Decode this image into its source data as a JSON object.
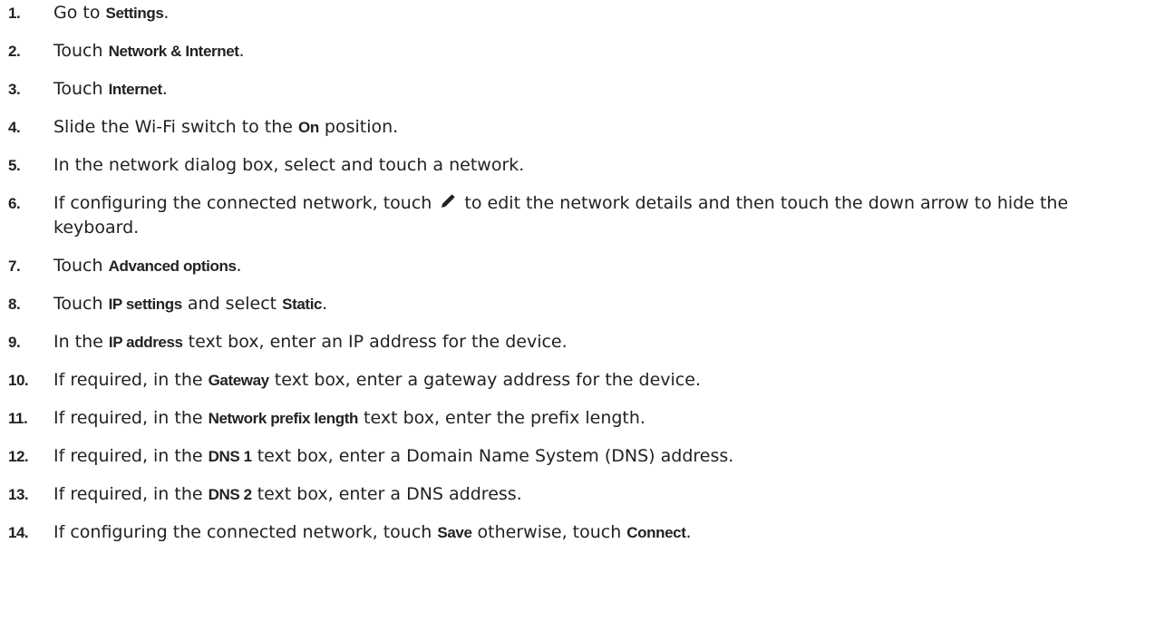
{
  "steps": [
    {
      "num": "1.",
      "parts": [
        {
          "t": "Go to "
        },
        {
          "b": "Settings"
        },
        {
          "t": "."
        }
      ]
    },
    {
      "num": "2.",
      "parts": [
        {
          "t": "Touch "
        },
        {
          "b": "Network & Internet"
        },
        {
          "t": "."
        }
      ]
    },
    {
      "num": "3.",
      "parts": [
        {
          "t": "Touch "
        },
        {
          "b": "Internet"
        },
        {
          "t": "."
        }
      ]
    },
    {
      "num": "4.",
      "parts": [
        {
          "t": "Slide the Wi-Fi switch to the "
        },
        {
          "b": "On"
        },
        {
          "t": " position."
        }
      ]
    },
    {
      "num": "5.",
      "parts": [
        {
          "t": "In the network dialog box, select and touch a network."
        }
      ]
    },
    {
      "num": "6.",
      "parts": [
        {
          "t": "If configuring the connected network, touch "
        },
        {
          "icon": "pencil-icon"
        },
        {
          "t": " to edit the network details and then touch the down arrow to hide the keyboard."
        }
      ]
    },
    {
      "num": "7.",
      "parts": [
        {
          "t": "Touch "
        },
        {
          "b": "Advanced options"
        },
        {
          "t": "."
        }
      ]
    },
    {
      "num": "8.",
      "parts": [
        {
          "t": "Touch "
        },
        {
          "b": "IP settings"
        },
        {
          "t": " and select "
        },
        {
          "b": "Static"
        },
        {
          "t": "."
        }
      ]
    },
    {
      "num": "9.",
      "parts": [
        {
          "t": "In the "
        },
        {
          "b": "IP address"
        },
        {
          "t": " text box, enter an IP address for the device."
        }
      ]
    },
    {
      "num": "10.",
      "parts": [
        {
          "t": "If required, in the "
        },
        {
          "b": "Gateway"
        },
        {
          "t": " text box, enter a gateway address for the device."
        }
      ]
    },
    {
      "num": "11.",
      "parts": [
        {
          "t": "If required, in the "
        },
        {
          "b": "Network prefix length"
        },
        {
          "t": " text box, enter the prefix length."
        }
      ]
    },
    {
      "num": "12.",
      "parts": [
        {
          "t": "If required, in the "
        },
        {
          "b": "DNS 1"
        },
        {
          "t": " text box, enter a Domain Name System (DNS) address."
        }
      ]
    },
    {
      "num": "13.",
      "parts": [
        {
          "t": "If required, in the "
        },
        {
          "b": "DNS 2"
        },
        {
          "t": " text box, enter a DNS address."
        }
      ]
    },
    {
      "num": "14.",
      "parts": [
        {
          "t": "If configuring the connected network, touch "
        },
        {
          "b": "Save"
        },
        {
          "t": " otherwise, touch "
        },
        {
          "b": "Connect"
        },
        {
          "t": "."
        }
      ]
    }
  ]
}
